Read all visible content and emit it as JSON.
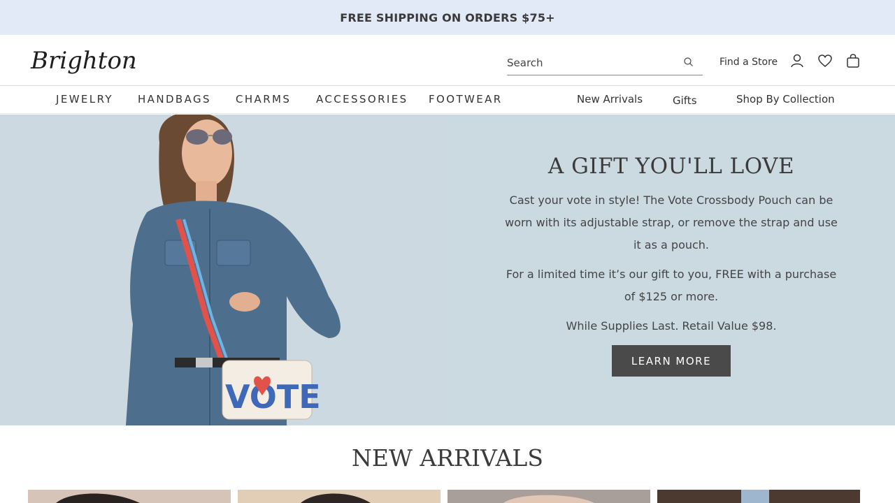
{
  "promo": {
    "text": "FREE SHIPPING ON ORDERS $75+"
  },
  "header": {
    "logo_text": "Brighton",
    "search_placeholder": "Search",
    "find_store": "Find a Store",
    "icons": [
      "search-icon",
      "account-icon",
      "heart-icon",
      "bag-icon"
    ]
  },
  "nav": {
    "categories": [
      "JEWELRY",
      "HANDBAGS",
      "CHARMS",
      "ACCESSORIES",
      "FOOTWEAR"
    ],
    "links": [
      "New Arrivals",
      "Gifts",
      "Shop By Collection"
    ]
  },
  "hero": {
    "title": "A GIFT YOU'LL LOVE",
    "p1": "Cast your vote in style! The Vote Crossbody Pouch can be worn with its adjustable strap, or remove the strap and use it as a pouch.",
    "p2": "For a limited time it’s our gift to you, FREE with a purchase of $125 or more.",
    "p3": "While Supplies Last. Retail Value $98.",
    "button": "LEARN MORE",
    "pouch_text": "VOTE"
  },
  "new_arrivals": {
    "title": "NEW ARRIVALS"
  },
  "colors": {
    "promo_bg": "#e3eaf7",
    "hero_bg": "#cbd9e1",
    "button_bg": "#4a4a4a"
  }
}
